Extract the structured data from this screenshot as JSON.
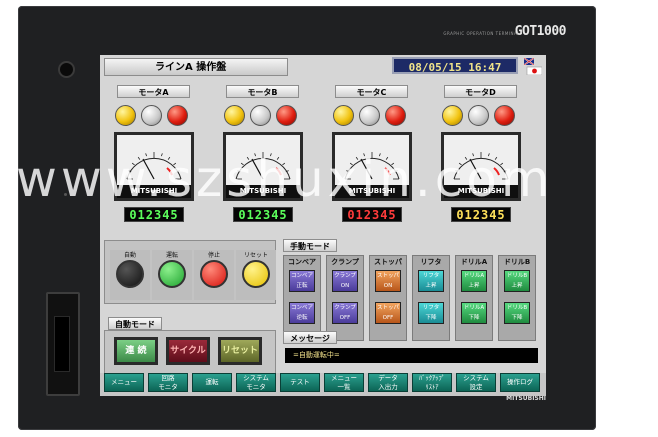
{
  "device": {
    "brand": "GOT1000",
    "brand_sub": "GRAPHIC OPERATION TERMINAL",
    "maker": "MITSUBISHI"
  },
  "screen": {
    "title": "ラインA 操作盤",
    "datetime": "08/05/15 16:47",
    "motors": [
      {
        "label": "モータA",
        "digits": "012345",
        "digit_color": "g"
      },
      {
        "label": "モータB",
        "digits": "012345",
        "digit_color": "g"
      },
      {
        "label": "モータC",
        "digits": "012345",
        "digit_color": "r"
      },
      {
        "label": "モータD",
        "digits": "012345",
        "digit_color": "y"
      }
    ],
    "meter_brand": "MITSUBISHI",
    "pushbuttons": [
      {
        "label": "自動",
        "color": "black"
      },
      {
        "label": "運転",
        "color": "green"
      },
      {
        "label": "停止",
        "color": "red"
      },
      {
        "label": "リセット",
        "color": "yellow"
      }
    ],
    "manual_mode_label": "手動モード",
    "manual_cols": [
      {
        "label": "コンベア",
        "color": "purple",
        "btns": [
          "コンベア\n正転",
          "コンベア\n逆転"
        ]
      },
      {
        "label": "クランプ",
        "color": "purple",
        "btns": [
          "クランプ\nON",
          "クランプ\nOFF"
        ]
      },
      {
        "label": "ストッパ",
        "color": "orange",
        "btns": [
          "ストッパ\nON",
          "ストッパ\nOFF"
        ]
      },
      {
        "label": "リフタ",
        "color": "teal",
        "btns": [
          "リフタ\n上昇",
          "リフタ\n下降"
        ]
      },
      {
        "label": "ドリルA",
        "color": "green",
        "btns": [
          "ドリルA\n上昇",
          "ドリルA\n下降"
        ]
      },
      {
        "label": "ドリルB",
        "color": "green",
        "btns": [
          "ドリルB\n上昇",
          "ドリルB\n下降"
        ]
      }
    ],
    "auto_mode_label": "自動モード",
    "auto_btns": [
      "連 続",
      "サイクル",
      "リセット"
    ],
    "message_label": "メッセージ",
    "message_text": "=自動運転中=",
    "nav": [
      "メニュー",
      "回路\nモニタ",
      "運転",
      "システム\nモニタ",
      "テスト",
      "メニュー\n一覧",
      "データ\n入出力",
      "ﾊﾞｯｸｱｯﾌﾟ\nﾘｽﾄｱ",
      "システム\n設定",
      "操作ログ"
    ]
  },
  "watermark": "www.szshuxin.com"
}
